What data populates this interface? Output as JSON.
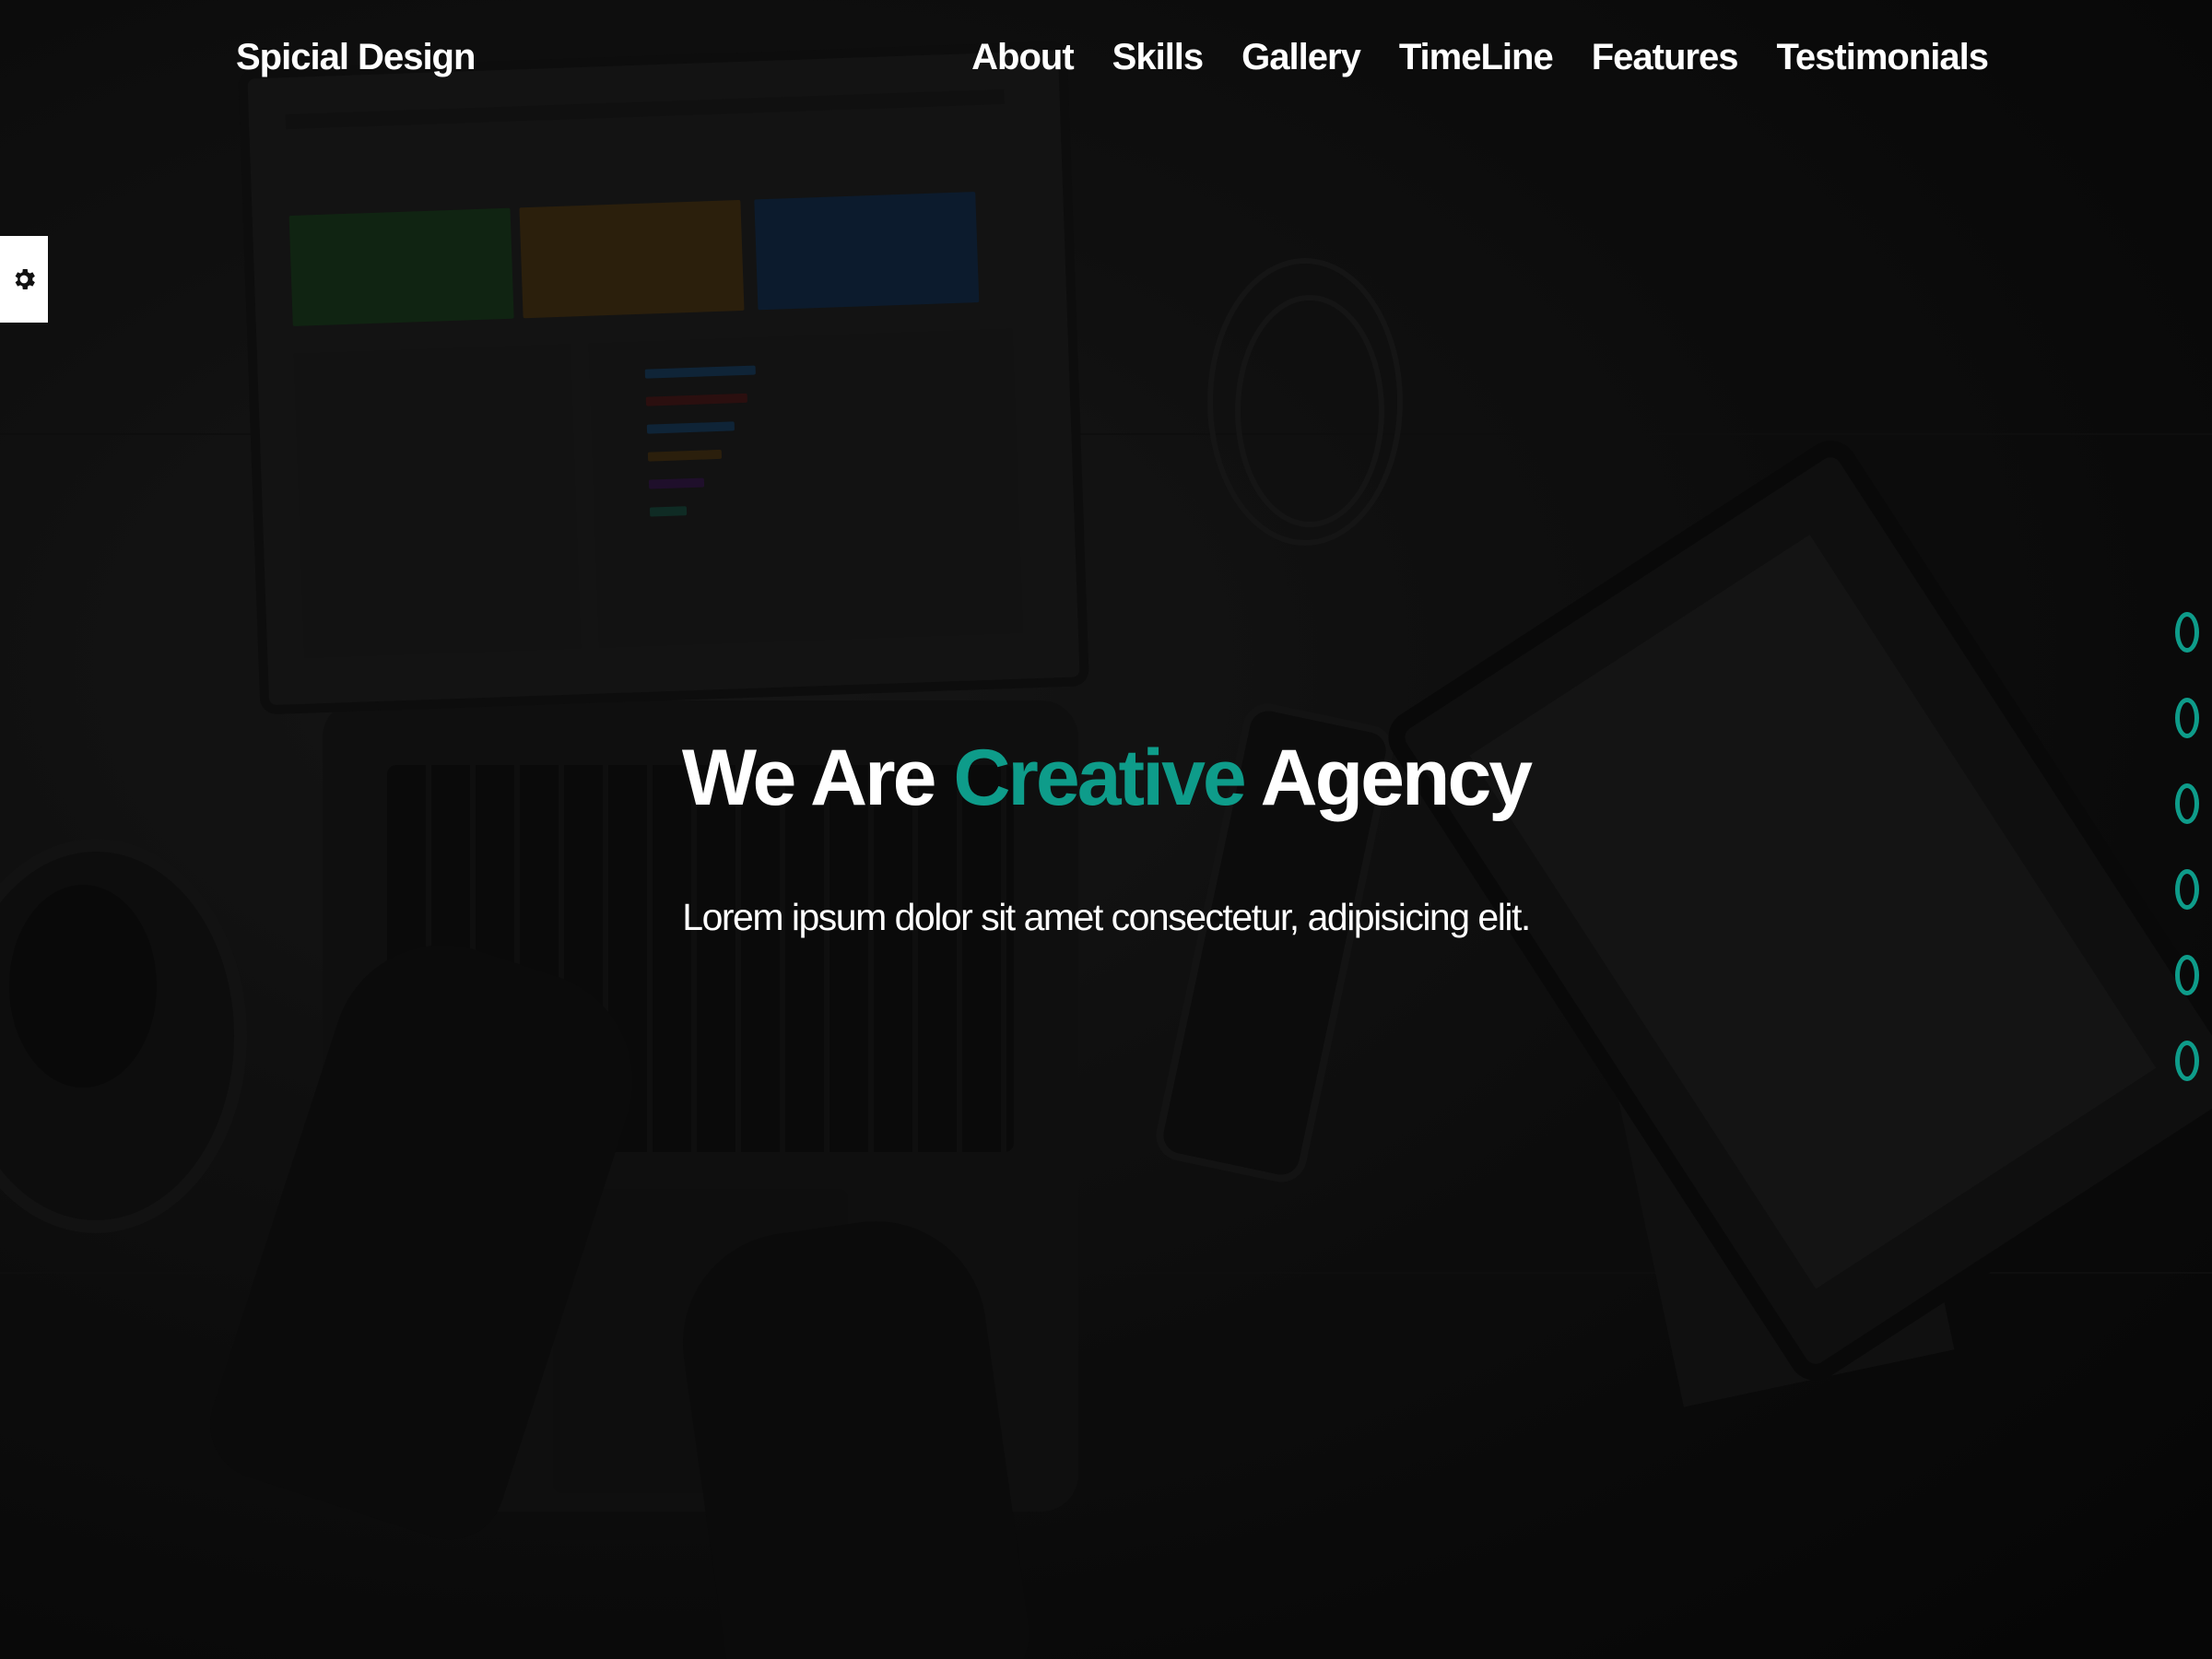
{
  "header": {
    "brand": "Spicial Design",
    "nav": [
      {
        "label": "About"
      },
      {
        "label": "Skills"
      },
      {
        "label": "Gallery"
      },
      {
        "label": "TimeLine"
      },
      {
        "label": "Features"
      },
      {
        "label": "Testimonials"
      }
    ]
  },
  "settings": {
    "icon": "gear-icon"
  },
  "hero": {
    "title_before": "We Are",
    "title_accent": "Creative",
    "title_after": "Agency",
    "subtitle": "Lorem ipsum dolor sit amet consectetur, adipisicing elit."
  },
  "bullets": {
    "count": 6
  },
  "colors": {
    "accent": "#0e9c8a",
    "text": "#ffffff",
    "background": "#0b0b0b"
  }
}
